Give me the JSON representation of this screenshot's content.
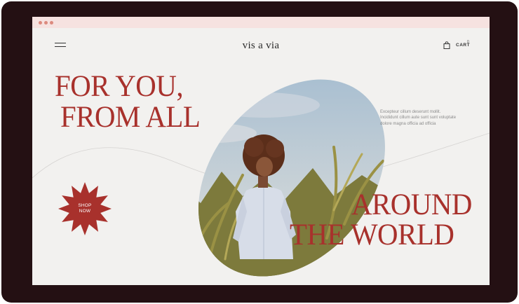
{
  "brand": "vis a via",
  "cart": {
    "label": "CART",
    "count": "0"
  },
  "hero": {
    "line1": "FOR YOU,",
    "line2": "FROM ALL",
    "line3": "AROUND",
    "line4": "THE WORLD",
    "description": "Excepteur cillum deserunt mollit. Incididunt cillum aute sunt sunt voluptate dolore magna officia ad officia"
  },
  "shop_button": {
    "line1": "SHOP",
    "line2": "NOW"
  },
  "colors": {
    "accent": "#a8312c",
    "page_bg": "#f2f1ef",
    "device_frame": "#241013",
    "titlebar": "#f6e2e0",
    "titlebar_dots": "#dc8a7e"
  },
  "icons": [
    "menu-icon",
    "shopping-bag-icon"
  ]
}
